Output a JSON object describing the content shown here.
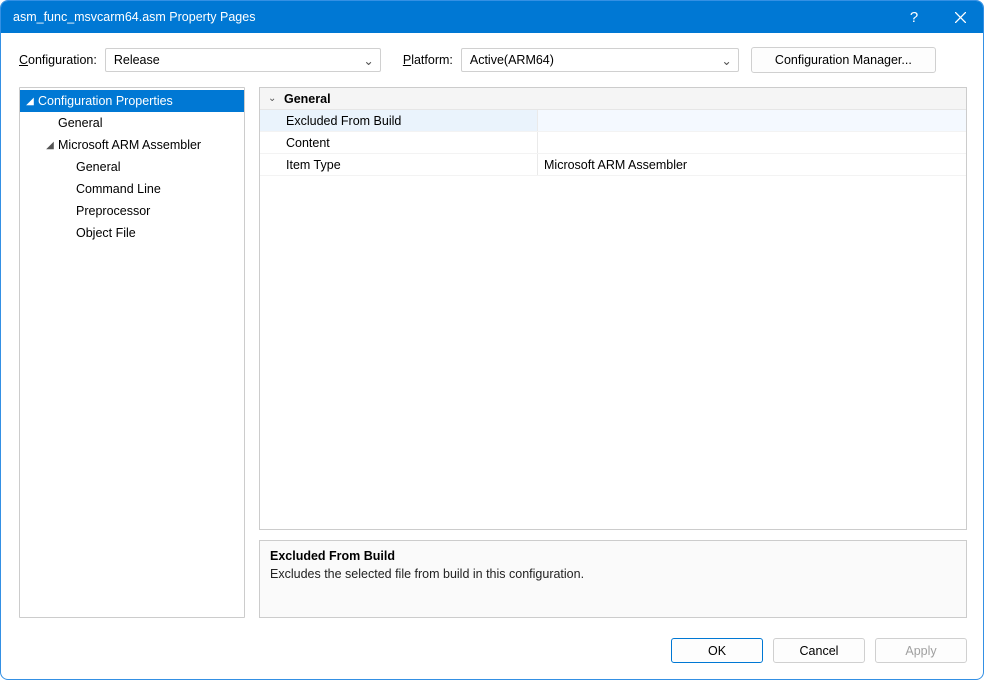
{
  "titlebar": {
    "title": "asm_func_msvcarm64.asm Property Pages",
    "help": "?"
  },
  "toolbar": {
    "configuration_label_pre": "C",
    "configuration_label_post": "onfiguration:",
    "configuration_value": "Release",
    "platform_label_pre": "P",
    "platform_label_post": "latform:",
    "platform_value": "Active(ARM64)",
    "config_manager": "Configuration Manager..."
  },
  "tree": {
    "root": "Configuration Properties",
    "general": "General",
    "asm_root": "Microsoft ARM Assembler",
    "asm_general": "General",
    "asm_cmdline": "Command Line",
    "asm_preproc": "Preprocessor",
    "asm_objfile": "Object File"
  },
  "grid": {
    "section": "General",
    "rows": {
      "excluded": {
        "name": "Excluded From Build",
        "value": ""
      },
      "content": {
        "name": "Content",
        "value": ""
      },
      "itemtype": {
        "name": "Item Type",
        "value": "Microsoft ARM Assembler"
      }
    }
  },
  "description": {
    "title": "Excluded From Build",
    "text": "Excludes the selected file from build in this configuration."
  },
  "footer": {
    "ok": "OK",
    "cancel": "Cancel",
    "apply": "Apply"
  }
}
